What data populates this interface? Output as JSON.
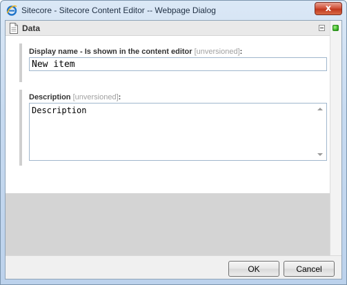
{
  "window": {
    "title": "Sitecore - Sitecore Content Editor -- Webpage Dialog",
    "close_label": "x"
  },
  "section": {
    "title": "Data"
  },
  "fields": [
    {
      "label": "Display name - Is shown in the content editor",
      "qualifier": "[unversioned]",
      "suffix": ":",
      "value": "New item"
    },
    {
      "label": "Description",
      "qualifier": "[unversioned]",
      "suffix": ":",
      "value": "Description"
    }
  ],
  "buttons": {
    "ok": "OK",
    "cancel": "Cancel"
  },
  "colors": {
    "status_indicator": "#2fae1e",
    "close_button": "#c0391f"
  }
}
